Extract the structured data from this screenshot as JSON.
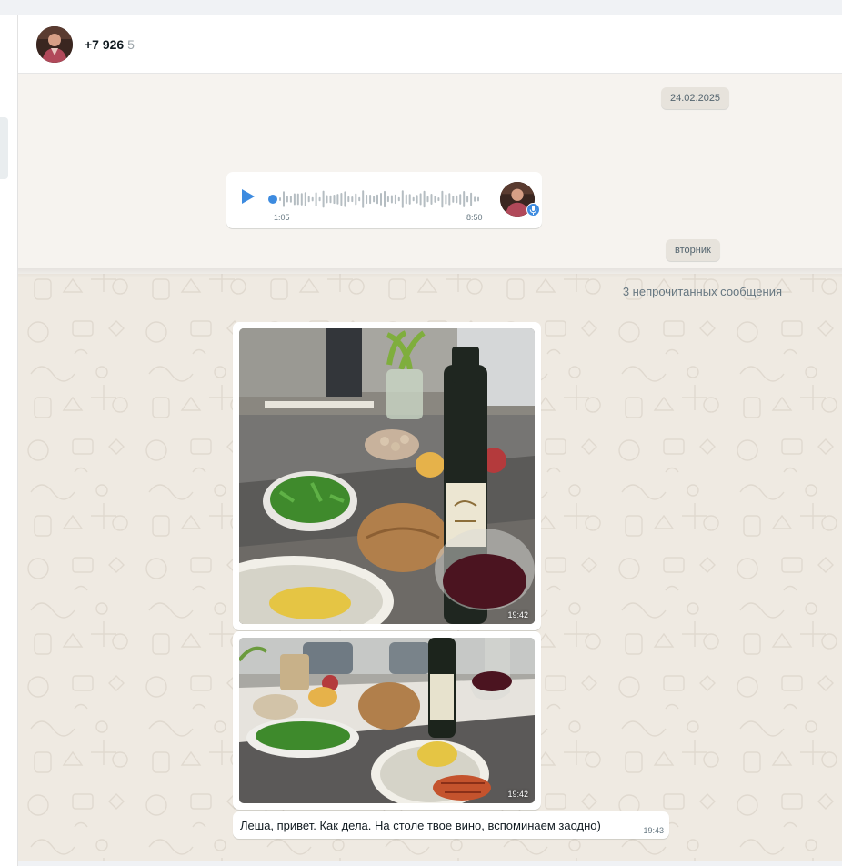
{
  "header": {
    "contact_name": "+7 926",
    "contact_name_tail": "5"
  },
  "messages": {
    "date_separator": "24.02.2025",
    "voice": {
      "current_time": "1:05",
      "duration": "8:50",
      "progress": 0.0
    },
    "day_separator": "вторник",
    "unread_label": "3 непрочитанных сообщения",
    "photo1": {
      "time": "19:42"
    },
    "photo2": {
      "time": "19:42"
    },
    "text1": {
      "text": "Леша, привет. Как дела. На столе твое вино, вспоминаем заодно)",
      "time": "19:43"
    }
  },
  "colors": {
    "accent": "#3d8be0",
    "chat_bg": "#efeae2",
    "bubble": "#ffffff"
  }
}
